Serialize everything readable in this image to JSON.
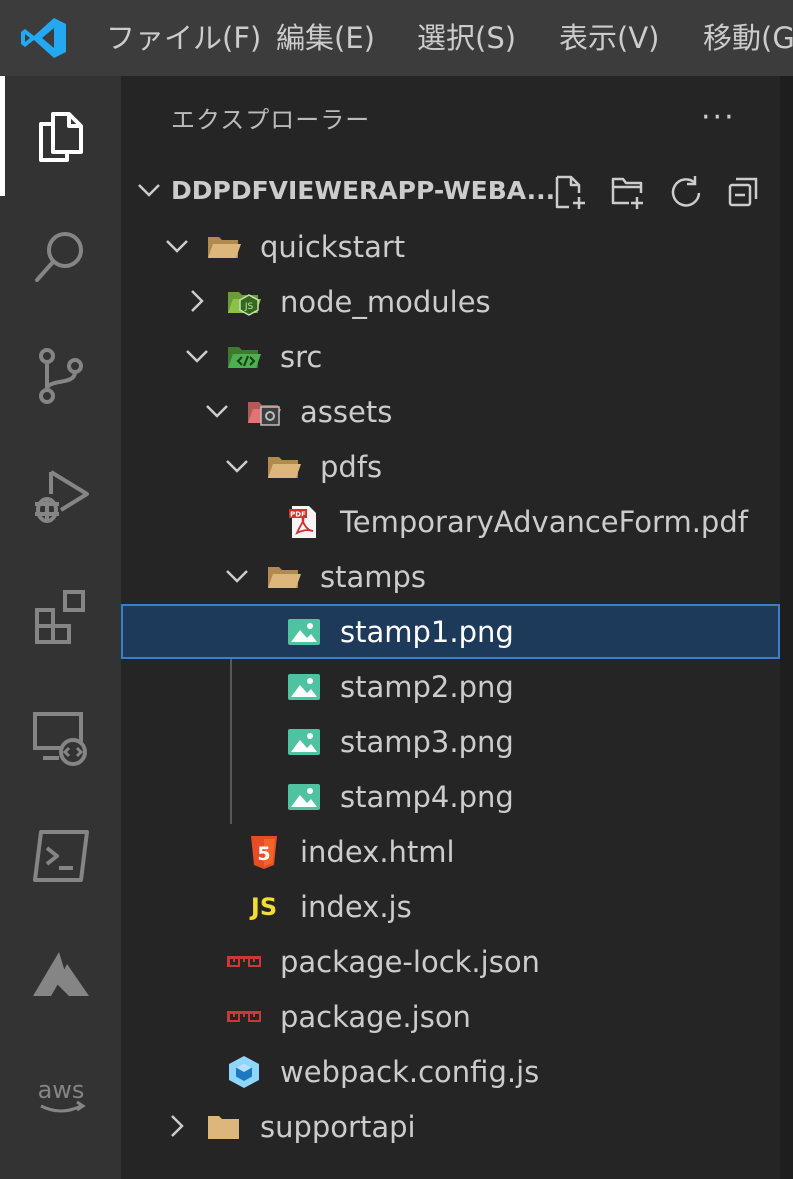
{
  "menubar": {
    "logo": "vscode-logo",
    "items": [
      "ファイル(F)",
      "編集(E)",
      "選択(S)",
      "表示(V)",
      "移動(G)"
    ]
  },
  "activitybar": {
    "items": [
      "explorer-icon",
      "search-icon",
      "source-control-icon",
      "run-debug-icon",
      "extensions-icon",
      "remote-explorer-icon",
      "terminal-icon",
      "azure-icon",
      "aws-icon"
    ],
    "active": "explorer-icon"
  },
  "sidebar": {
    "title": "エクスプローラー",
    "more": "···",
    "root": {
      "label": "DDPDFVIEWERAPP-WEBA...",
      "actions": [
        "new-file-icon",
        "new-folder-icon",
        "refresh-icon",
        "collapse-all-icon"
      ]
    },
    "tree": [
      {
        "label": "quickstart",
        "depth": 0,
        "chevron": "down",
        "icon": "folder-open-icon"
      },
      {
        "label": "node_modules",
        "depth": 1,
        "chevron": "right",
        "icon": "node-folder-icon"
      },
      {
        "label": "src",
        "depth": 1,
        "chevron": "down",
        "icon": "src-folder-icon"
      },
      {
        "label": "assets",
        "depth": 2,
        "chevron": "down",
        "icon": "assets-folder-icon"
      },
      {
        "label": "pdfs",
        "depth": 3,
        "chevron": "down",
        "icon": "folder-open-icon"
      },
      {
        "label": "TemporaryAdvanceForm.pdf",
        "depth": 4,
        "chevron": "none",
        "icon": "pdf-file-icon"
      },
      {
        "label": "stamps",
        "depth": 3,
        "chevron": "down",
        "icon": "folder-open-icon"
      },
      {
        "label": "stamp1.png",
        "depth": 4,
        "chevron": "none",
        "icon": "image-file-icon",
        "selected": true
      },
      {
        "label": "stamp2.png",
        "depth": 4,
        "chevron": "none",
        "icon": "image-file-icon"
      },
      {
        "label": "stamp3.png",
        "depth": 4,
        "chevron": "none",
        "icon": "image-file-icon"
      },
      {
        "label": "stamp4.png",
        "depth": 4,
        "chevron": "none",
        "icon": "image-file-icon"
      },
      {
        "label": "index.html",
        "depth": 2,
        "chevron": "none",
        "icon": "html-file-icon"
      },
      {
        "label": "index.js",
        "depth": 2,
        "chevron": "none",
        "icon": "js-file-icon",
        "icon_text": "JS"
      },
      {
        "label": "package-lock.json",
        "depth": 1,
        "chevron": "none",
        "icon": "npm-file-icon"
      },
      {
        "label": "package.json",
        "depth": 1,
        "chevron": "none",
        "icon": "npm-file-icon"
      },
      {
        "label": "webpack.config.js",
        "depth": 1,
        "chevron": "none",
        "icon": "webpack-file-icon"
      },
      {
        "label": "supportapi",
        "depth": 0,
        "chevron": "right",
        "icon": "folder-closed-icon"
      }
    ]
  },
  "colors": {
    "menubar_bg": "#3c3c3c",
    "activitybar_bg": "#333333",
    "sidebar_bg": "#252526",
    "selection_bg": "#1e3a5a",
    "selection_border": "#3c7fc9",
    "folder": "#dcb67a",
    "image": "#4fc3a1",
    "html": "#e44d26",
    "js": "#f1dd35",
    "npm": "#cb3837"
  }
}
